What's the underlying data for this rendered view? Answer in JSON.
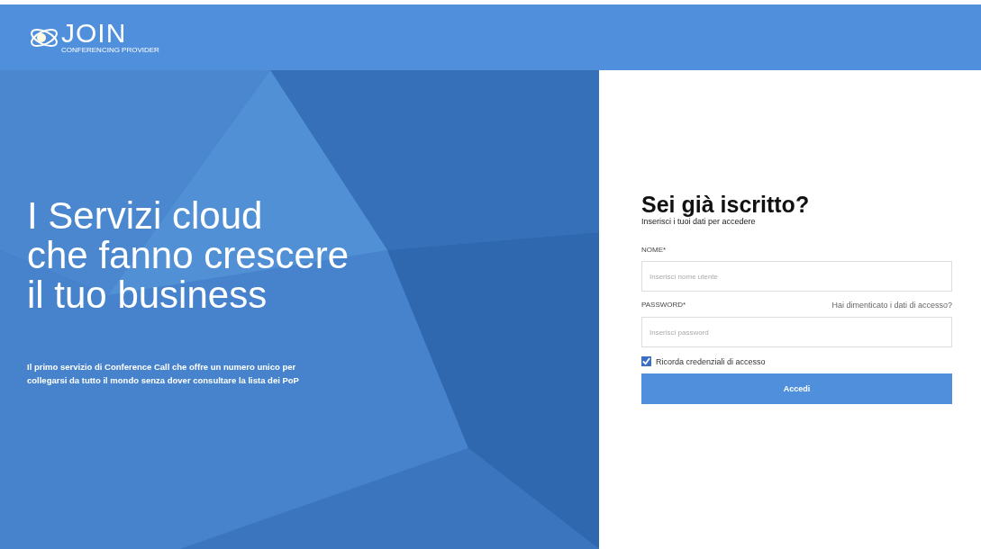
{
  "header": {
    "logo": {
      "name": "JOIN",
      "tagline": "CONFERENCING PROVIDER"
    }
  },
  "hero": {
    "headline_lines": [
      "I Servizi cloud",
      "che fanno crescere",
      "il tuo business"
    ],
    "description": "Il primo servizio di Conference Call che offre un numero unico per collegarsi da tutto il mondo senza dover consultare la lista dei PoP"
  },
  "login": {
    "title": "Sei già iscritto?",
    "subtitle": "Inserisci i tuoi dati per accedere",
    "fields": [
      {
        "label": "NOME*",
        "placeholder": "Inserisci nome utente"
      },
      {
        "label": "PASSWORD*",
        "placeholder": "Inserisci password",
        "link": "Hai dimenticato i dati di accesso?"
      }
    ],
    "remember": {
      "label": "Ricorda credenziali di accesso",
      "checked": true
    },
    "submit": "Accedi"
  }
}
